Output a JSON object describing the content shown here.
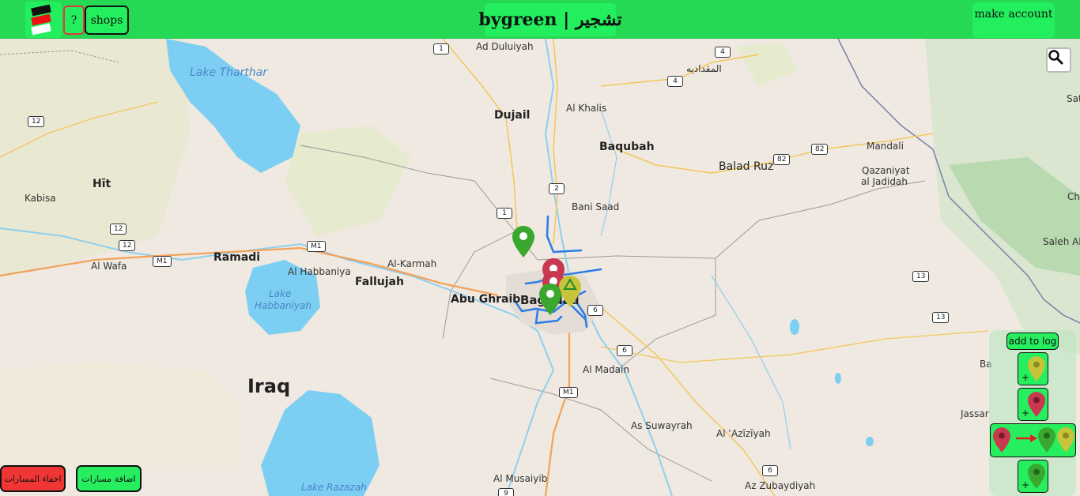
{
  "header": {
    "help_label": "?",
    "shops_label": "shops",
    "brand_title": "bygreen | تشجير",
    "account_label": "make account"
  },
  "map": {
    "places": {
      "lake_tharthar": "Lake Tharthar",
      "ad_duluiyah": "Ad Duluiyah",
      "almuqdadiyah": "المقداديه",
      "dujail": "Dujail",
      "al_khalis": "Al Khalis",
      "baqubah": "Baqubah",
      "mandali": "Mandali",
      "balad_ruz": "Balad Ruz",
      "qazaniyat": "Qazaniyat",
      "al_jadidah": "al Jadidah",
      "hit": "Hīt",
      "kabisa": "Kabisa",
      "bani_saad": "Bani Saad",
      "al_wafa": "Al Wafa",
      "ramadi": "Ramadi",
      "al_habbaniya": "Al Habbaniya",
      "fallujah": "Fallujah",
      "al_karmah": "Al-Karmah",
      "abu_ghraib": "Abu Ghraib",
      "baghdad": "Baghdad",
      "lake_habbaniyah_1": "Lake",
      "lake_habbaniyah_2": "Habbaniyah",
      "al_madain": "Al Madain",
      "iraq": "Iraq",
      "as_suwayrah": "As Suwayrah",
      "al_aziziyah": "Al ʿAzīzīyah",
      "al_musaiyib": "Al Musaiyib",
      "lake_razazah": "Lake Razazah",
      "az_zubaydiyah": "Az Zubaydiyah",
      "sat": "Sat",
      "cha": "Cha",
      "saleh_ab": "Saleh Ab",
      "ba": "Ba",
      "jassar": "Jassar"
    },
    "shields": [
      "1",
      "4",
      "4",
      "12",
      "82",
      "82",
      "2",
      "1",
      "12",
      "12",
      "M1",
      "M1",
      "6",
      "13",
      "13",
      "6",
      "M1",
      "6",
      "9"
    ]
  },
  "controls": {
    "hide_routes_label": "اخفاء المسارات",
    "add_routes_label": "اضافة مسارات",
    "add_to_log_label": "add to log",
    "plus": "+"
  },
  "colors": {
    "brand_green": "#26d955",
    "button_green": "#22ee5e",
    "danger_red": "#f03535",
    "marker_green": "#3aa72f",
    "marker_red": "#c9384e",
    "marker_yellow": "#c8c43a",
    "route_blue": "#2f7ee6",
    "water": "#7ccff2"
  },
  "icons": [
    "logo-stripes-icon",
    "search-icon",
    "green-marker-icon",
    "red-marker-icon",
    "yellow-marker-icon",
    "red-arrow-icon",
    "recycle-icon"
  ]
}
